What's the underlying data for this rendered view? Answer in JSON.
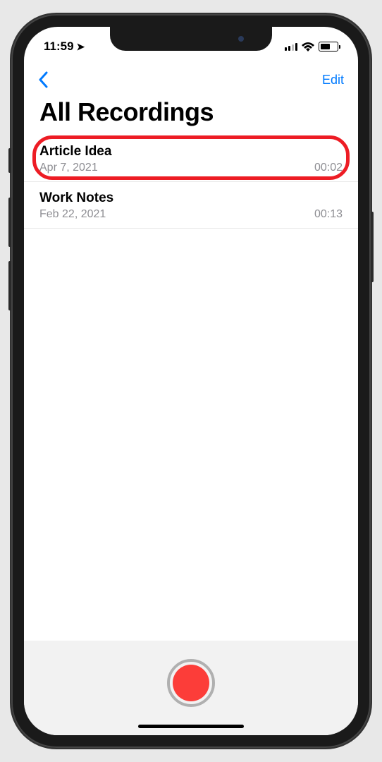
{
  "status": {
    "time": "11:59",
    "location_icon": "➤"
  },
  "nav": {
    "edit": "Edit"
  },
  "title": "All Recordings",
  "recordings": [
    {
      "title": "Article Idea",
      "date": "Apr 7, 2021",
      "duration": "00:02",
      "highlighted": true
    },
    {
      "title": "Work Notes",
      "date": "Feb 22, 2021",
      "duration": "00:13",
      "highlighted": false
    }
  ]
}
